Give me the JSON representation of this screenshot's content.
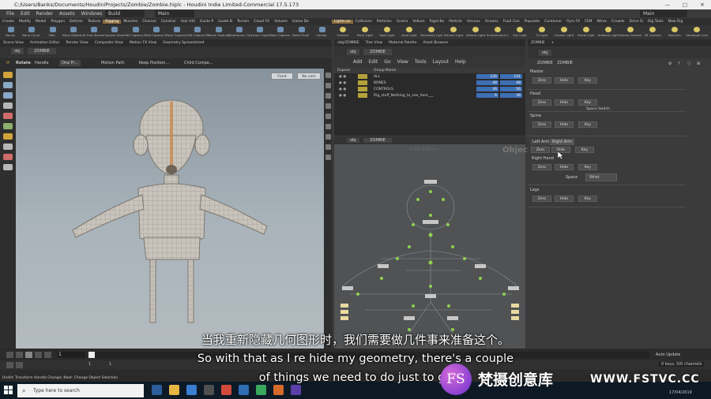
{
  "window": {
    "title": "C:/Users/Banks/Documents/HoudiniProjects/Zombie/Zombie.hiplc - Houdini Indie Limited-Commercial 17.5.173",
    "min": "—",
    "max": "□",
    "close": "✕"
  },
  "menu": [
    "File",
    "Edit",
    "Render",
    "Assets",
    "Windows",
    "Help"
  ],
  "desktops": {
    "left": "Build",
    "left2": "Main",
    "right": "Main"
  },
  "shelf_tabs": [
    "Create",
    "Modify",
    "Model",
    "Polygon",
    "Deform",
    "Texture",
    "Rigging",
    "Muscles",
    "Charact",
    "Constrai",
    "Hair Util",
    "Guide P",
    "Guide B",
    "Terrain",
    "Cloud FX",
    "Volume",
    "Game De"
  ],
  "shelf_active": "Rigging",
  "shelf_tools": [
    "Bones",
    "Bone Curve",
    "Path",
    "Bone Objects",
    "IK from Bones",
    "Capture Geometry",
    "Edit Capture Regions",
    "Edit Capture Weights",
    "Paint Capture Weights",
    "Edit Capture Regions",
    "Blend Capture Weights",
    "Biharmonic Capture",
    "Extract Capture Bones",
    "Bake Capture Weights",
    "Delta Mush",
    "Combo"
  ],
  "light_tabs": [
    "Lights an",
    "Collisions",
    "Particles",
    "Grains",
    "Vellum",
    "Rigid Bo",
    "Particle",
    "Viscous",
    "Oceans",
    "Fluid Con",
    "Populate",
    "Container",
    "Pyro FX",
    "FEM",
    "Wires",
    "Crowds",
    "Drive Si",
    "Rig Tools",
    "New Rig"
  ],
  "light_active": "Lights an",
  "light_tools": [
    "Camera",
    "Point Light",
    "Spot Light",
    "Area Light",
    "Geometry Light",
    "Volume Light",
    "Distant Light",
    "Environment Light",
    "Sky Light",
    "GI Light",
    "Caustic Light",
    "Portal Light",
    "Ambient Light",
    "Stereo Camera",
    "VR Camera",
    "Switcher",
    "Gamepad Camera"
  ],
  "pane_tabs": [
    "Scene View",
    "Animation Editor",
    "Render View",
    "Composite View",
    "Motion FX View",
    "Geometry Spreadsheet"
  ],
  "viewport": {
    "path_obj": "obj",
    "path_node": "ZOMBIE",
    "state": "Rotate",
    "handle": "Handle",
    "hold": "One Fr...",
    "motion": "Motion Path",
    "keep": "Keep Position...",
    "child": "Child Compe...",
    "cam_front": "Front",
    "cam_nocam": "No cam"
  },
  "mid_tabs": [
    "/obj/ZOMBIE",
    "Tree View",
    "Material Palette",
    "Asset Browser"
  ],
  "mid": {
    "path_obj": "obj",
    "path_node": "ZOMBIE",
    "menu": [
      "Add",
      "Edit",
      "Go",
      "View",
      "Tools",
      "Layout",
      "Help"
    ],
    "list_head": {
      "expose": "Expose",
      "name": "Group Name",
      "count": ""
    },
    "groups": [
      {
        "name": "ALL",
        "count": "126",
        "c2": "141"
      },
      {
        "name": "BONES",
        "count": "48",
        "c2": "48"
      },
      {
        "name": "CONTROLS",
        "count": "36",
        "c2": "56"
      },
      {
        "name": "Rig_stuff_Nothing_to_see_here___",
        "count": "6",
        "c2": "36"
      }
    ],
    "net_path_obj": "obj",
    "net_path_node": "ZOMBIE",
    "net_edition": "Indie Edition",
    "net_label": "Objects"
  },
  "right_tabs": [
    "ZOMBIE",
    "+"
  ],
  "params": {
    "path_obj": "obj",
    "head_type": "ZOMBIE",
    "head_name": "ZOMBIE",
    "sections": [
      {
        "label": "Master",
        "buttons": [
          "Zero",
          "Hide",
          "Key"
        ]
      },
      {
        "label": "Head",
        "buttons": [
          "Zero",
          "Hide",
          "Key"
        ],
        "check": "Space Switch"
      },
      {
        "label": "Spine",
        "buttons": [
          "Zero",
          "Hide",
          "Key"
        ]
      }
    ],
    "arm_tabs": [
      "Left Arm",
      "Right Arm"
    ],
    "arm_buttons": [
      "Zero",
      "Hide",
      "Key"
    ],
    "right_hand": {
      "label": "Right Hand",
      "buttons": [
        "Zero",
        "Hide",
        "Key"
      ],
      "space_label": "Space",
      "space_value": "Wrist"
    },
    "legs": {
      "label": "Legs",
      "buttons": [
        "Zero",
        "Hide",
        "Key"
      ]
    }
  },
  "timeline": {
    "frame": "1",
    "start": "1",
    "start2": "1",
    "end": "1",
    "keys": "0 keys, 0/0 channels",
    "auto": "Auto Update"
  },
  "status": "Undid: Transform Handle Change; Next: Change Object Selection",
  "taskbar": {
    "search": "Type here to search",
    "time": "17/04/2019"
  },
  "subtitles": {
    "cn": "当我重新隐藏几何图形时，我们需要做几件事来准备这个。",
    "en1": "So with that as I re hide my geometry, there's a couple",
    "en2": "of things we need to do just to ge"
  },
  "watermark": {
    "logo": "FS",
    "name": "梵摄创意库",
    "url": "WWW.FSTVC.CC"
  },
  "colors": {
    "accent": "#8a6d3b",
    "group_node": "#b5a13a",
    "count_bg": "#3d6fb5",
    "node_green": "#8fd14f"
  }
}
